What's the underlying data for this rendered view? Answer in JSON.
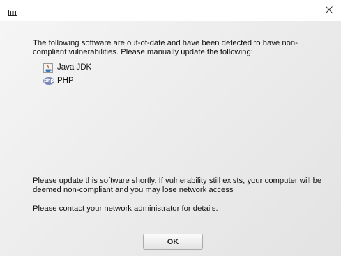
{
  "titlebar": {
    "app_icon": "app-icon",
    "close_icon": "close-icon",
    "close_label": "×"
  },
  "main": {
    "intro": "The following software are out-of-date and have been detected to have non-compliant vulnerabilities. Please manually update the following:",
    "software": [
      {
        "name": "Java JDK",
        "icon": "java-icon"
      },
      {
        "name": "PHP",
        "icon": "php-icon",
        "icon_text": "php"
      }
    ],
    "warning": "Please update this software shortly. If vulnerability still exists, your computer will be deemed non-compliant and you may lose network access",
    "contact": "Please contact your network administrator for details."
  },
  "footer": {
    "ok_label": "OK"
  },
  "colors": {
    "php_badge": "#7a86b8",
    "titlebar_bg": "#ffffff",
    "dialog_bg": "#ededed"
  }
}
